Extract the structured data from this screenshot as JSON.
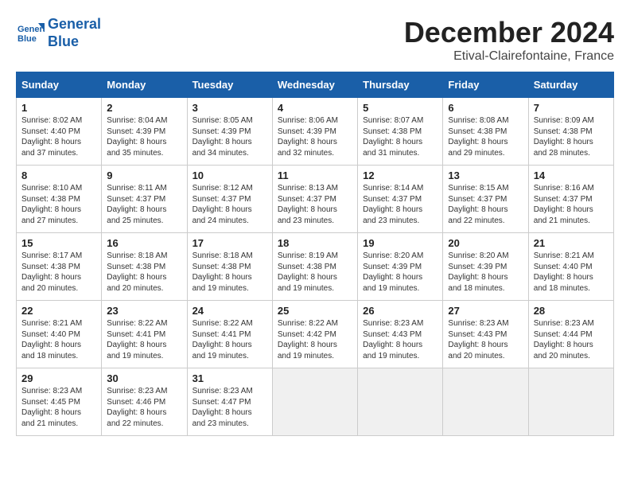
{
  "header": {
    "logo_line1": "General",
    "logo_line2": "Blue",
    "month": "December 2024",
    "location": "Etival-Clairefontaine, France"
  },
  "days": [
    "Sunday",
    "Monday",
    "Tuesday",
    "Wednesday",
    "Thursday",
    "Friday",
    "Saturday"
  ],
  "weeks": [
    [
      {
        "date": "1",
        "sunrise": "Sunrise: 8:02 AM",
        "sunset": "Sunset: 4:40 PM",
        "daylight": "Daylight: 8 hours and 37 minutes."
      },
      {
        "date": "2",
        "sunrise": "Sunrise: 8:04 AM",
        "sunset": "Sunset: 4:39 PM",
        "daylight": "Daylight: 8 hours and 35 minutes."
      },
      {
        "date": "3",
        "sunrise": "Sunrise: 8:05 AM",
        "sunset": "Sunset: 4:39 PM",
        "daylight": "Daylight: 8 hours and 34 minutes."
      },
      {
        "date": "4",
        "sunrise": "Sunrise: 8:06 AM",
        "sunset": "Sunset: 4:39 PM",
        "daylight": "Daylight: 8 hours and 32 minutes."
      },
      {
        "date": "5",
        "sunrise": "Sunrise: 8:07 AM",
        "sunset": "Sunset: 4:38 PM",
        "daylight": "Daylight: 8 hours and 31 minutes."
      },
      {
        "date": "6",
        "sunrise": "Sunrise: 8:08 AM",
        "sunset": "Sunset: 4:38 PM",
        "daylight": "Daylight: 8 hours and 29 minutes."
      },
      {
        "date": "7",
        "sunrise": "Sunrise: 8:09 AM",
        "sunset": "Sunset: 4:38 PM",
        "daylight": "Daylight: 8 hours and 28 minutes."
      }
    ],
    [
      {
        "date": "8",
        "sunrise": "Sunrise: 8:10 AM",
        "sunset": "Sunset: 4:38 PM",
        "daylight": "Daylight: 8 hours and 27 minutes."
      },
      {
        "date": "9",
        "sunrise": "Sunrise: 8:11 AM",
        "sunset": "Sunset: 4:37 PM",
        "daylight": "Daylight: 8 hours and 25 minutes."
      },
      {
        "date": "10",
        "sunrise": "Sunrise: 8:12 AM",
        "sunset": "Sunset: 4:37 PM",
        "daylight": "Daylight: 8 hours and 24 minutes."
      },
      {
        "date": "11",
        "sunrise": "Sunrise: 8:13 AM",
        "sunset": "Sunset: 4:37 PM",
        "daylight": "Daylight: 8 hours and 23 minutes."
      },
      {
        "date": "12",
        "sunrise": "Sunrise: 8:14 AM",
        "sunset": "Sunset: 4:37 PM",
        "daylight": "Daylight: 8 hours and 23 minutes."
      },
      {
        "date": "13",
        "sunrise": "Sunrise: 8:15 AM",
        "sunset": "Sunset: 4:37 PM",
        "daylight": "Daylight: 8 hours and 22 minutes."
      },
      {
        "date": "14",
        "sunrise": "Sunrise: 8:16 AM",
        "sunset": "Sunset: 4:37 PM",
        "daylight": "Daylight: 8 hours and 21 minutes."
      }
    ],
    [
      {
        "date": "15",
        "sunrise": "Sunrise: 8:17 AM",
        "sunset": "Sunset: 4:38 PM",
        "daylight": "Daylight: 8 hours and 20 minutes."
      },
      {
        "date": "16",
        "sunrise": "Sunrise: 8:18 AM",
        "sunset": "Sunset: 4:38 PM",
        "daylight": "Daylight: 8 hours and 20 minutes."
      },
      {
        "date": "17",
        "sunrise": "Sunrise: 8:18 AM",
        "sunset": "Sunset: 4:38 PM",
        "daylight": "Daylight: 8 hours and 19 minutes."
      },
      {
        "date": "18",
        "sunrise": "Sunrise: 8:19 AM",
        "sunset": "Sunset: 4:38 PM",
        "daylight": "Daylight: 8 hours and 19 minutes."
      },
      {
        "date": "19",
        "sunrise": "Sunrise: 8:20 AM",
        "sunset": "Sunset: 4:39 PM",
        "daylight": "Daylight: 8 hours and 19 minutes."
      },
      {
        "date": "20",
        "sunrise": "Sunrise: 8:20 AM",
        "sunset": "Sunset: 4:39 PM",
        "daylight": "Daylight: 8 hours and 18 minutes."
      },
      {
        "date": "21",
        "sunrise": "Sunrise: 8:21 AM",
        "sunset": "Sunset: 4:40 PM",
        "daylight": "Daylight: 8 hours and 18 minutes."
      }
    ],
    [
      {
        "date": "22",
        "sunrise": "Sunrise: 8:21 AM",
        "sunset": "Sunset: 4:40 PM",
        "daylight": "Daylight: 8 hours and 18 minutes."
      },
      {
        "date": "23",
        "sunrise": "Sunrise: 8:22 AM",
        "sunset": "Sunset: 4:41 PM",
        "daylight": "Daylight: 8 hours and 19 minutes."
      },
      {
        "date": "24",
        "sunrise": "Sunrise: 8:22 AM",
        "sunset": "Sunset: 4:41 PM",
        "daylight": "Daylight: 8 hours and 19 minutes."
      },
      {
        "date": "25",
        "sunrise": "Sunrise: 8:22 AM",
        "sunset": "Sunset: 4:42 PM",
        "daylight": "Daylight: 8 hours and 19 minutes."
      },
      {
        "date": "26",
        "sunrise": "Sunrise: 8:23 AM",
        "sunset": "Sunset: 4:43 PM",
        "daylight": "Daylight: 8 hours and 19 minutes."
      },
      {
        "date": "27",
        "sunrise": "Sunrise: 8:23 AM",
        "sunset": "Sunset: 4:43 PM",
        "daylight": "Daylight: 8 hours and 20 minutes."
      },
      {
        "date": "28",
        "sunrise": "Sunrise: 8:23 AM",
        "sunset": "Sunset: 4:44 PM",
        "daylight": "Daylight: 8 hours and 20 minutes."
      }
    ],
    [
      {
        "date": "29",
        "sunrise": "Sunrise: 8:23 AM",
        "sunset": "Sunset: 4:45 PM",
        "daylight": "Daylight: 8 hours and 21 minutes."
      },
      {
        "date": "30",
        "sunrise": "Sunrise: 8:23 AM",
        "sunset": "Sunset: 4:46 PM",
        "daylight": "Daylight: 8 hours and 22 minutes."
      },
      {
        "date": "31",
        "sunrise": "Sunrise: 8:23 AM",
        "sunset": "Sunset: 4:47 PM",
        "daylight": "Daylight: 8 hours and 23 minutes."
      },
      null,
      null,
      null,
      null
    ]
  ]
}
